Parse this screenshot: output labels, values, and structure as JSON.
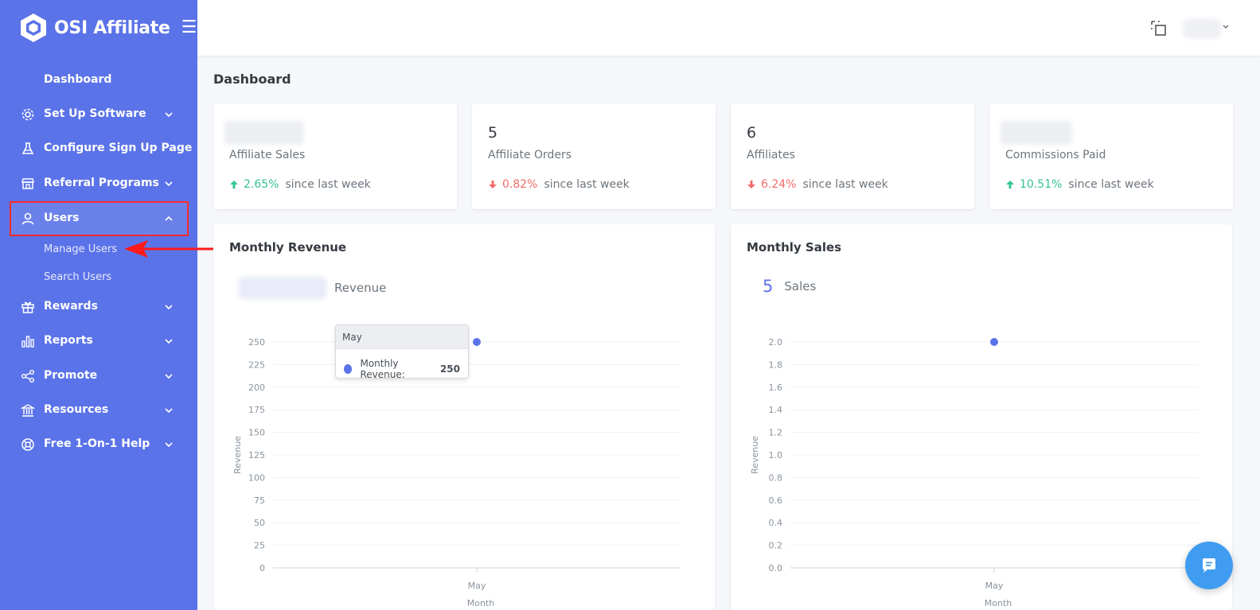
{
  "brand": {
    "name": "OSI Affiliate"
  },
  "sidebar": {
    "items": [
      {
        "label": "Dashboard"
      },
      {
        "label": "Set Up Software"
      },
      {
        "label": "Configure Sign Up Page"
      },
      {
        "label": "Referral Programs"
      },
      {
        "label": "Users"
      },
      {
        "label": "Rewards"
      },
      {
        "label": "Reports"
      },
      {
        "label": "Promote"
      },
      {
        "label": "Resources"
      },
      {
        "label": "Free 1-On-1 Help"
      }
    ],
    "users_sub": [
      {
        "label": "Manage Users"
      },
      {
        "label": "Search Users"
      }
    ]
  },
  "page": {
    "title": "Dashboard"
  },
  "stats": [
    {
      "value": "",
      "label": "Affiliate Sales",
      "trend": "up",
      "pct": "2.65%",
      "since": "since last week"
    },
    {
      "value": "5",
      "label": "Affiliate Orders",
      "trend": "down",
      "pct": "0.82%",
      "since": "since last week"
    },
    {
      "value": "6",
      "label": "Affiliates",
      "trend": "down",
      "pct": "6.24%",
      "since": "since last week"
    },
    {
      "value": "",
      "label": "Commissions Paid",
      "trend": "up",
      "pct": "10.51%",
      "since": "since last week"
    }
  ],
  "colors": {
    "accent": "#5b73e8",
    "up": "#34c38f",
    "down": "#f46a6a",
    "highlight": "#ff2a2a"
  },
  "chart_data": [
    {
      "type": "scatter",
      "title": "Monthly Revenue",
      "summary_label": "Revenue",
      "xlabel": "Month",
      "ylabel": "Revenue",
      "categories": [
        "May"
      ],
      "series": [
        {
          "name": "Monthly Revenue",
          "values": [
            250
          ]
        }
      ],
      "ylim": [
        0,
        250
      ],
      "yticks": [
        "0",
        "25",
        "50",
        "75",
        "100",
        "125",
        "150",
        "175",
        "200",
        "225",
        "250"
      ],
      "tooltip": {
        "title": "May",
        "label": "Monthly Revenue:",
        "value": "250"
      }
    },
    {
      "type": "scatter",
      "title": "Monthly Sales",
      "summary_value": "5",
      "summary_label": "Sales",
      "xlabel": "Month",
      "ylabel": "Revenue",
      "categories": [
        "May"
      ],
      "series": [
        {
          "values": [
            2
          ]
        }
      ],
      "ylim": [
        0,
        2
      ],
      "yticks": [
        "0.0",
        "0.2",
        "0.4",
        "0.6",
        "0.8",
        "1.0",
        "1.2",
        "1.4",
        "1.6",
        "1.8",
        "2.0"
      ]
    }
  ]
}
